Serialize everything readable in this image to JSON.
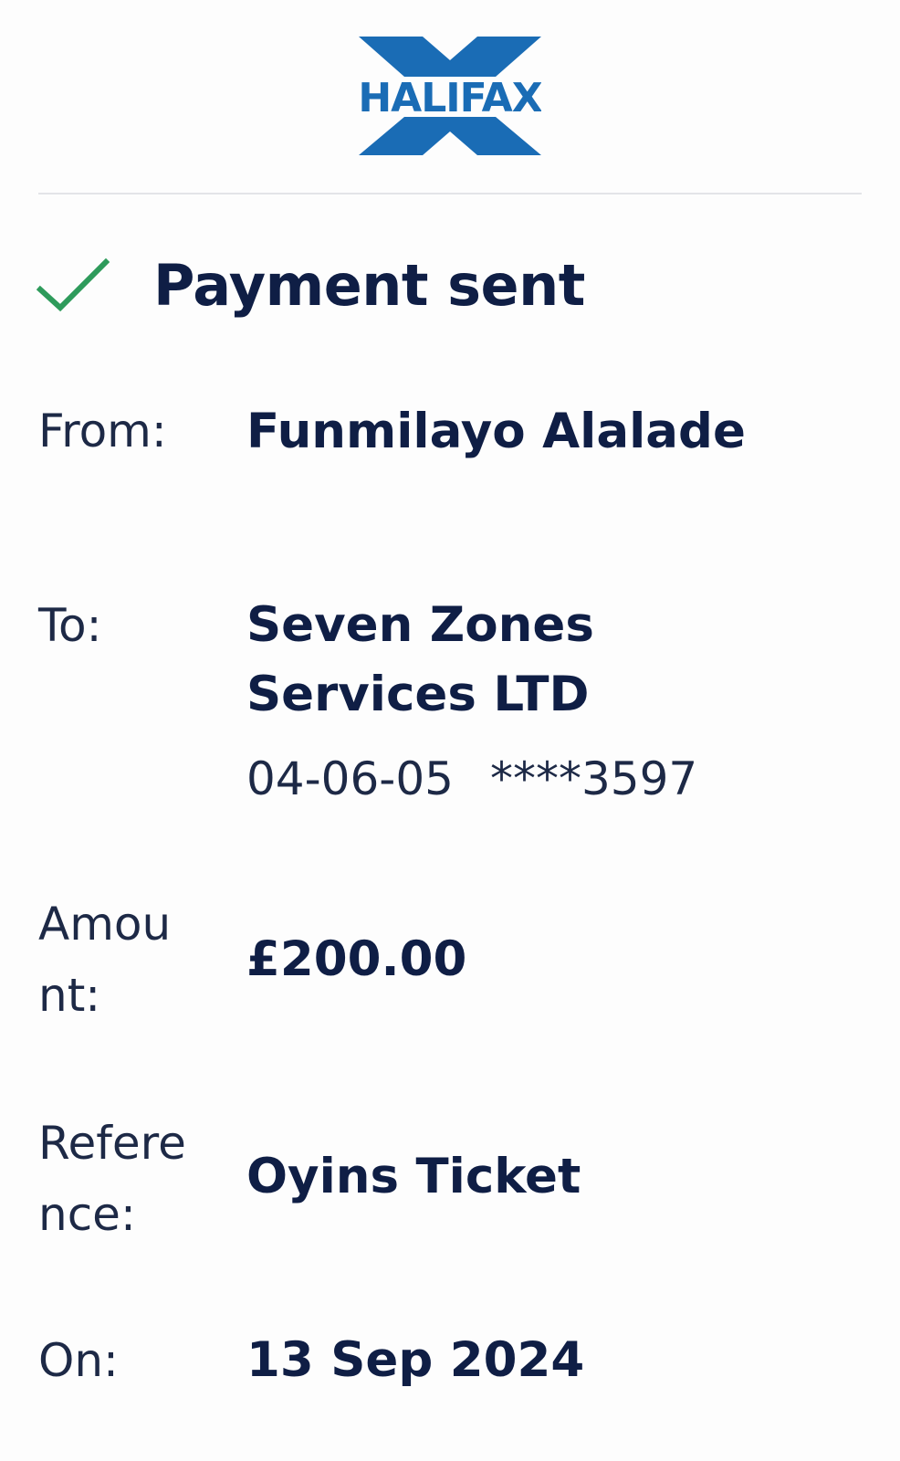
{
  "brand": {
    "logo_text": "HALIFAX",
    "colors": {
      "logo_blue": "#1a6cb5",
      "text_navy": "#0f1e45",
      "check_green": "#2e9b5b",
      "divider": "#e3e4e8"
    }
  },
  "status": {
    "icon": "check-icon",
    "title": "Payment sent"
  },
  "details": {
    "from_label": "From:",
    "from_value": "Funmilayo Alalade",
    "to_label": "To:",
    "to_name_line1": "Seven Zones",
    "to_name_line2": "Services LTD",
    "to_sort_code": "04-06-05",
    "to_account": "****3597",
    "amount_label_line1": "Amou",
    "amount_label_line2": "nt:",
    "amount_value": "£200.00",
    "reference_label_line1": "Refere",
    "reference_label_line2": "nce:",
    "reference_value": "Oyins Ticket",
    "on_label": "On:",
    "on_value": "13 Sep 2024"
  }
}
